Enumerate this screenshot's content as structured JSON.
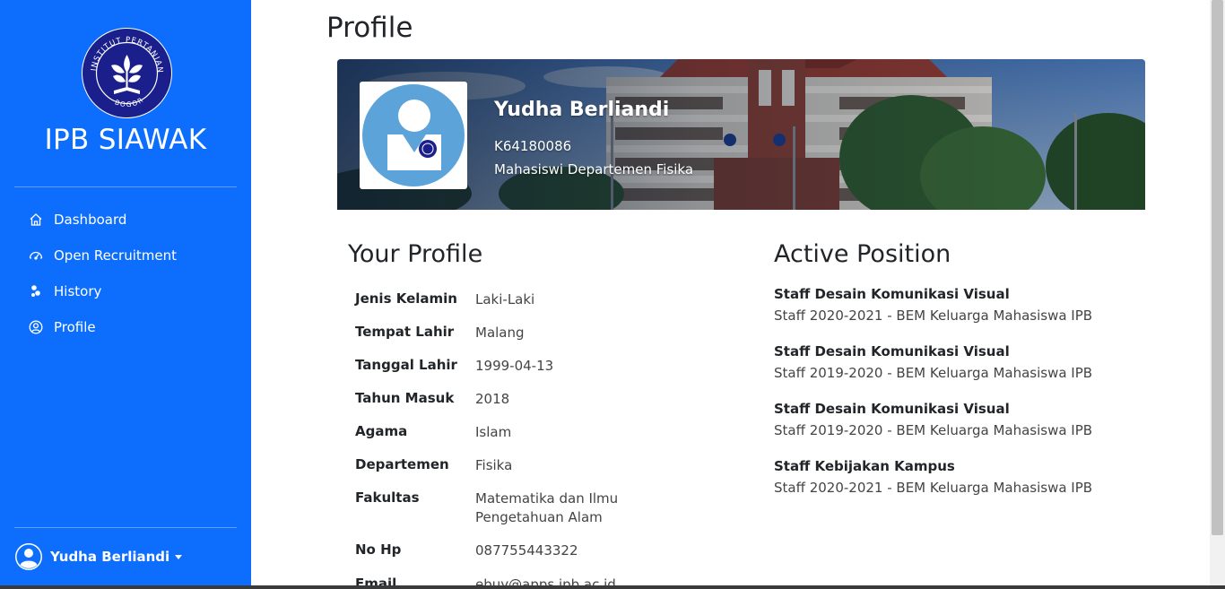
{
  "sidebar": {
    "brand": "IPB SIAWAK",
    "logo_text_top": "INSTITUT PERTANIAN",
    "logo_text_bottom": "BOGOR",
    "items": [
      {
        "label": "Dashboard",
        "icon": "home-icon"
      },
      {
        "label": "Open Recruitment",
        "icon": "speedometer-icon"
      },
      {
        "label": "History",
        "icon": "history-icon"
      },
      {
        "label": "Profile",
        "icon": "person-circle-icon"
      }
    ],
    "user": {
      "name": "Yudha Berliandi",
      "icon": "user-avatar-icon"
    }
  },
  "main": {
    "title": "Profile",
    "banner": {
      "name": "Yudha Berliandi",
      "nim": "K64180086",
      "department": "Mahasiswi Departemen Fisika"
    },
    "your_profile": {
      "title": "Your Profile",
      "rows": [
        {
          "label": "Jenis Kelamin",
          "value": "Laki-Laki"
        },
        {
          "label": "Tempat Lahir",
          "value": "Malang"
        },
        {
          "label": "Tanggal Lahir",
          "value": "1999-04-13"
        },
        {
          "label": "Tahun Masuk",
          "value": "2018"
        },
        {
          "label": "Agama",
          "value": "Islam"
        },
        {
          "label": "Departemen",
          "value": "Fisika"
        },
        {
          "label": "Fakultas",
          "value": "Matematika dan Ilmu Pengetahuan Alam"
        },
        {
          "label": "No Hp",
          "value": "087755443322"
        },
        {
          "label": "Email",
          "value": "ebuy@apps.ipb.ac.id"
        }
      ]
    },
    "active_position": {
      "title": "Active Position",
      "items": [
        {
          "title": "Staff Desain Komunikasi Visual",
          "subtitle": "Staff 2020-2021 - BEM Keluarga Mahasiswa IPB"
        },
        {
          "title": "Staff Desain Komunikasi Visual",
          "subtitle": "Staff 2019-2020 - BEM Keluarga Mahasiswa IPB"
        },
        {
          "title": "Staff Desain Komunikasi Visual",
          "subtitle": "Staff 2019-2020 - BEM Keluarga Mahasiswa IPB"
        },
        {
          "title": "Staff Kebijakan Kampus",
          "subtitle": "Staff 2020-2021 - BEM Keluarga Mahasiswa IPB"
        }
      ]
    }
  },
  "colors": {
    "sidebar": "#0d6efd",
    "logo_bg": "#1a1f8c",
    "avatar_bg": "#5ba3d9"
  }
}
